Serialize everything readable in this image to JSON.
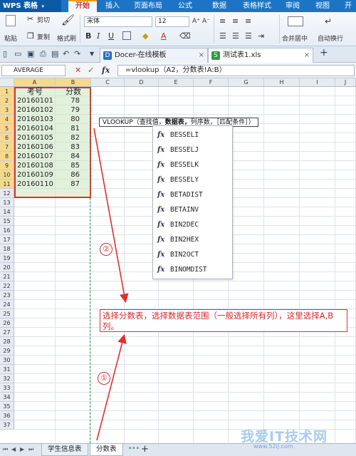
{
  "app": {
    "name": "WPS 表格",
    "caret": "▾"
  },
  "ribbon_tabs": [
    "开始",
    "插入",
    "页面布局",
    "公式",
    "数据",
    "表格样式",
    "审阅",
    "视图",
    "开"
  ],
  "ribbon": {
    "cut": "剪切",
    "paste": "粘贴",
    "copy": "复制",
    "format_painter": "格式刷",
    "font_name": "宋体",
    "font_size": "12",
    "bold": "B",
    "italic": "I",
    "underline": "U",
    "merge_center": "合并居中",
    "wrap_text": "自动换行",
    "font_grow": "A⁺",
    "font_shrink": "A⁻",
    "font_color": "A"
  },
  "doc_tabs": [
    {
      "label": "Docer-在线模板",
      "close": "×",
      "icon": "D",
      "color": "#2b6fc1"
    },
    {
      "label": "测试表1.xls",
      "close": "×",
      "icon": "S",
      "color": "#2f9b47"
    }
  ],
  "add_tab": "+",
  "formula_bar": {
    "name_box": "AVERAGE",
    "cancel": "✕",
    "accept": "✓",
    "fx": "fx",
    "formula": "=vlookup（A2，分数表!A:B）"
  },
  "columns": [
    "A",
    "B",
    "C",
    "D",
    "E",
    "F",
    "G",
    "H",
    "I",
    "J"
  ],
  "rows": [
    "1",
    "2",
    "3",
    "4",
    "5",
    "6",
    "7",
    "8",
    "9",
    "10",
    "11",
    "12",
    "13",
    "14",
    "15",
    "16",
    "17",
    "18",
    "19",
    "20",
    "21",
    "22",
    "23",
    "24",
    "25",
    "26",
    "27",
    "28",
    "29",
    "30",
    "31",
    "32",
    "33",
    "34",
    "35",
    "36",
    "37"
  ],
  "table": {
    "headers": [
      "考号",
      "分数"
    ],
    "data": [
      [
        "20160101",
        "78"
      ],
      [
        "20160102",
        "79"
      ],
      [
        "20160103",
        "80"
      ],
      [
        "20160104",
        "81"
      ],
      [
        "20160105",
        "82"
      ],
      [
        "20160106",
        "83"
      ],
      [
        "20160107",
        "84"
      ],
      [
        "20160108",
        "85"
      ],
      [
        "20160109",
        "86"
      ],
      [
        "20160110",
        "87"
      ]
    ]
  },
  "tooltip": {
    "fn": "VLOOKUP（",
    "arg1": "查找值，",
    "arg2": "数据表，",
    "arg3": "列序数，［匹配条件］）"
  },
  "autocomplete": {
    "fx": "fx",
    "items": [
      "BESSELI",
      "BESSELJ",
      "BESSELK",
      "BESSELY",
      "BETADIST",
      "BETAINV",
      "BIN2DEC",
      "BIN2HEX",
      "BIN2OCT",
      "BINOMDIST"
    ]
  },
  "annotation": {
    "note": "选择分数表，选择数据表范围（一般选择所有列），这里选择A,B列。",
    "step1": "①",
    "step2": "②",
    "color": "#d9323a"
  },
  "sheet_tabs": [
    "学生信息表",
    "分数表"
  ],
  "sheet_more": "•••",
  "sheet_add": "+",
  "watermark": {
    "main": "我爱IT技术网",
    "sub": "www.52ij.com"
  }
}
